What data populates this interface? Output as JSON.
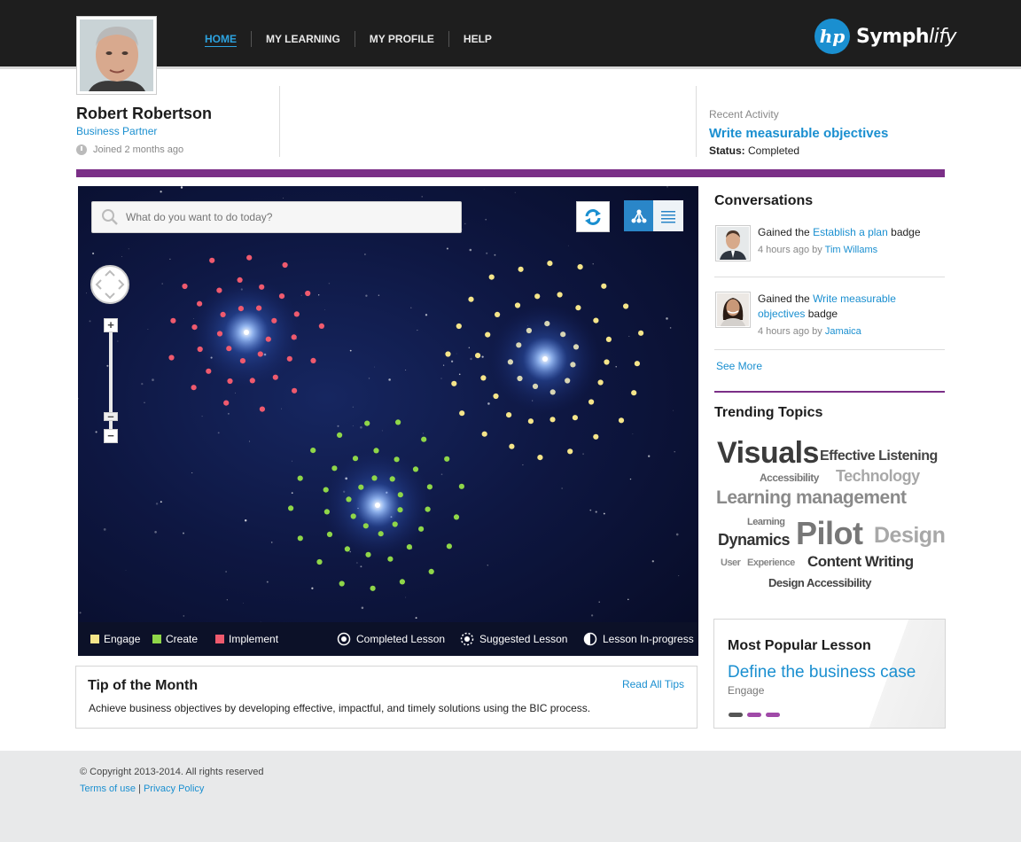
{
  "nav": {
    "items": [
      {
        "label": "HOME",
        "active": true
      },
      {
        "label": "MY LEARNING",
        "active": false
      },
      {
        "label": "MY PROFILE",
        "active": false
      },
      {
        "label": "HELP",
        "active": false
      }
    ]
  },
  "brand": {
    "logo": "hp",
    "name_bold": "Symph",
    "name_italic": "lify"
  },
  "profile": {
    "name": "Robert Robertson",
    "role": "Business Partner",
    "joined": "Joined 2 months ago"
  },
  "recent": {
    "label": "Recent Activity",
    "title": "Write measurable objectives",
    "status_label": "Status:",
    "status_value": "Completed"
  },
  "map": {
    "search_placeholder": "What do you want to do today?",
    "legend": {
      "engage": "Engage",
      "create": "Create",
      "implement": "Implement",
      "completed": "Completed Lesson",
      "suggested": "Suggested Lesson",
      "in_progress": "Lesson In-progress"
    },
    "colors": {
      "engage": "#f5e58a",
      "create": "#8fd649",
      "implement": "#ef5a6e"
    }
  },
  "tip": {
    "title": "Tip of the Month",
    "link": "Read All Tips",
    "text": "Achieve business objectives by developing effective, impactful, and timely solutions using the BIC process."
  },
  "conversations": {
    "title": "Conversations",
    "items": [
      {
        "prefix": "Gained the",
        "badge": "Establish a plan",
        "suffix": "badge",
        "time": "4 hours ago by",
        "user": "Tim Willams"
      },
      {
        "prefix": "Gained the",
        "badge": "Write measurable objectives",
        "suffix": "badge",
        "time": "4 hours ago by",
        "user": "Jamaica"
      }
    ],
    "see_more": "See More"
  },
  "trending": {
    "title": "Trending Topics",
    "topics": [
      "Visuals",
      "Effective Listening",
      "Accessibility",
      "Technology",
      "Learning management",
      "Learning",
      "Dynamics",
      "Pilot",
      "Design",
      "User",
      "Experience",
      "Content Writing",
      "Design Accessibility"
    ]
  },
  "popular": {
    "title": "Most Popular Lesson",
    "lesson": "Define the business case",
    "category": "Engage"
  },
  "footer": {
    "copyright": "© Copyright 2013-2014. All rights reserved",
    "terms": "Terms of use",
    "separator": "|",
    "privacy": "Privacy Policy"
  }
}
